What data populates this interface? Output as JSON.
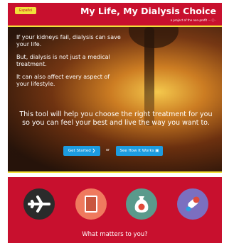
{
  "header": {
    "language_button": "Español",
    "title": "My Life, My Dialysis Choice",
    "tagline": "a project of the non-profit ··· ⓒ ·"
  },
  "hero": {
    "line1": "If your kidneys fail, dialysis can save your life.",
    "line2": "But, dialysis is not just a medical treatment.",
    "line3": "It can also affect every aspect of your lifestyle.",
    "message": "This tool will help you choose the right treatment for you so you can feel your best and live the way you want to.",
    "get_started": "Get Started ❯",
    "or": "or",
    "see_how": "See How It Works ▣"
  },
  "icons": [
    "airplane-icon",
    "book-icon",
    "money-bag-icon",
    "pills-icon"
  ],
  "section": {
    "heading": "What matters to you?"
  },
  "colors": {
    "brand_red": "#c8102e",
    "accent_yellow": "#f2e13a",
    "button_blue": "#1d9ce0"
  }
}
